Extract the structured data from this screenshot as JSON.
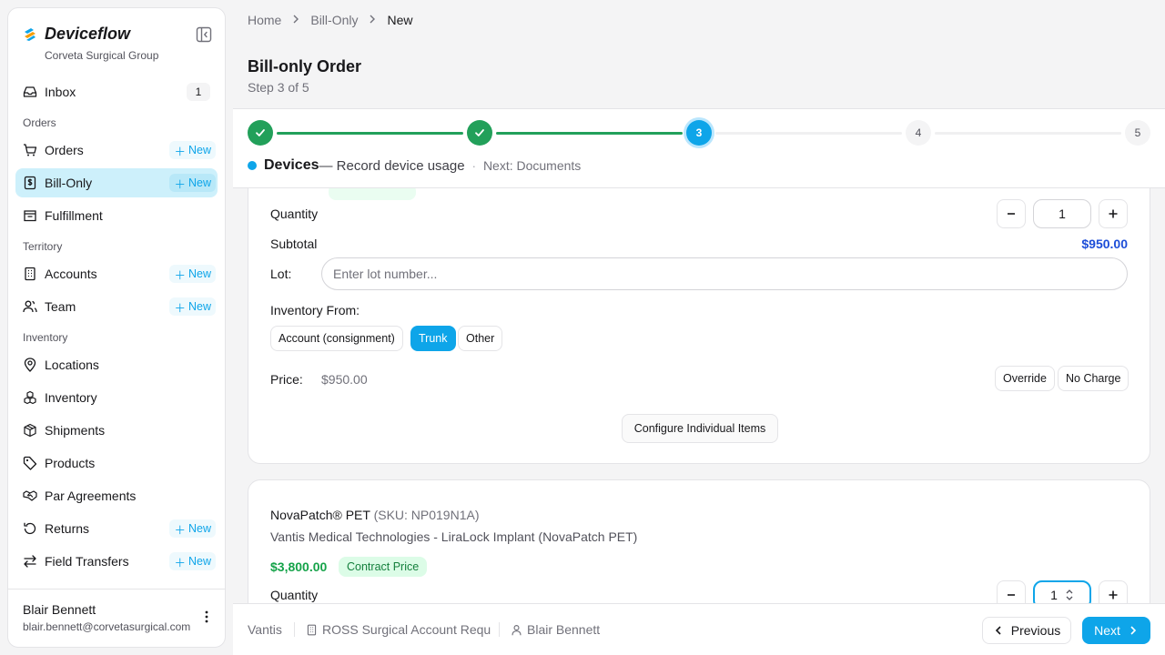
{
  "brand": {
    "name": "Deviceflow",
    "org": "Corveta Surgical Group"
  },
  "sidebar": {
    "inbox": {
      "label": "Inbox",
      "count": "1"
    },
    "sections": {
      "orders": "Orders",
      "territory": "Territory",
      "inventory": "Inventory"
    },
    "items": {
      "orders": "Orders",
      "bill_only": "Bill-Only",
      "fulfillment": "Fulfillment",
      "accounts": "Accounts",
      "team": "Team",
      "locations": "Locations",
      "inventory": "Inventory",
      "shipments": "Shipments",
      "products": "Products",
      "par_agreements": "Par Agreements",
      "returns": "Returns",
      "field_transfers": "Field Transfers"
    },
    "new_label": "New",
    "active_item": "bill_only"
  },
  "user": {
    "name": "Blair Bennett",
    "email": "blair.bennett@corvetasurgical.com"
  },
  "breadcrumb": [
    "Home",
    "Bill-Only",
    "New"
  ],
  "page": {
    "title": "Bill-only Order",
    "subtitle": "Step 3 of 5"
  },
  "stepper": {
    "steps": [
      "",
      "",
      "3",
      "4",
      "5"
    ],
    "current": 3,
    "step_name": "Devices",
    "step_desc": "— Record device usage",
    "separator": "·",
    "next": "Next: Documents"
  },
  "device1": {
    "quantity_label": "Quantity",
    "quantity": "1",
    "subtotal_label": "Subtotal",
    "subtotal": "$950.00",
    "lot_label": "Lot:",
    "lot_placeholder": "Enter lot number...",
    "inventory_from_label": "Inventory From:",
    "inventory_options": [
      "Account (consignment)",
      "Trunk",
      "Other"
    ],
    "inventory_selected": "Trunk",
    "price_label": "Price:",
    "price": "$950.00",
    "override_label": "Override",
    "no_charge_label": "No Charge",
    "configure_label": "Configure Individual Items"
  },
  "device2": {
    "name": "NovaPatch® PET",
    "sku": "(SKU: NP019N1A)",
    "description": "Vantis Medical Technologies - LiraLock Implant (NovaPatch PET)",
    "price": "$3,800.00",
    "price_badge": "Contract Price",
    "quantity_label": "Quantity",
    "quantity": "1"
  },
  "footer": {
    "vendor": "Vantis",
    "account": "ROSS Surgical Account Requ",
    "rep": "Blair Bennett",
    "previous_label": "Previous",
    "next_label": "Next"
  },
  "colors": {
    "accent": "#0ea5e9",
    "success": "#22a05a",
    "active_nav": "#cdf0fb"
  }
}
